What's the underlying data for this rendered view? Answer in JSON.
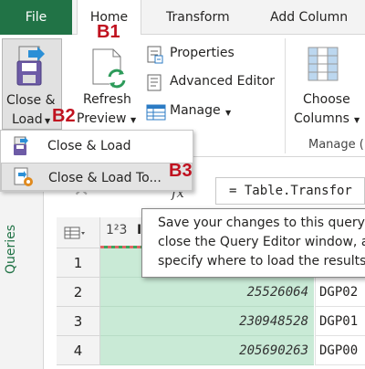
{
  "tabs": {
    "file": "File",
    "home": "Home",
    "transform": "Transform",
    "add_column": "Add Column"
  },
  "ribbon": {
    "close_load_line1": "Close &",
    "close_load_line2": "Load",
    "refresh_line1": "Refresh",
    "refresh_line2": "Preview",
    "properties": "Properties",
    "advanced_editor": "Advanced Editor",
    "manage": "Manage",
    "choose_line1": "Choose",
    "choose_line2": "Columns",
    "manage_group_label": "Manage ("
  },
  "callouts": {
    "b1": "B1",
    "b2": "B2",
    "b3": "B3"
  },
  "dropdown": {
    "items": [
      {
        "label": "Close & Load"
      },
      {
        "label": "Close & Load To..."
      }
    ]
  },
  "side_pane": {
    "label": "Queries"
  },
  "formula_bar": {
    "text": "= Table.Transfor",
    "fx": "fx"
  },
  "grid": {
    "header_type": "1²3",
    "header_label": "I",
    "rows": [
      {
        "num": "1",
        "id": "",
        "code": ""
      },
      {
        "num": "2",
        "id": "25526064",
        "code": "DGP02"
      },
      {
        "num": "3",
        "id": "230948528",
        "code": "DGP01"
      },
      {
        "num": "4",
        "id": "205690263",
        "code": "DGP00"
      }
    ]
  },
  "tooltip": {
    "lines": [
      "Save your changes to this query,",
      "close the Query Editor window, a",
      "specify where to load the results."
    ]
  },
  "colors": {
    "accent_green": "#217346",
    "callout_red": "#c0111f",
    "column_green": "#c9ead6"
  }
}
